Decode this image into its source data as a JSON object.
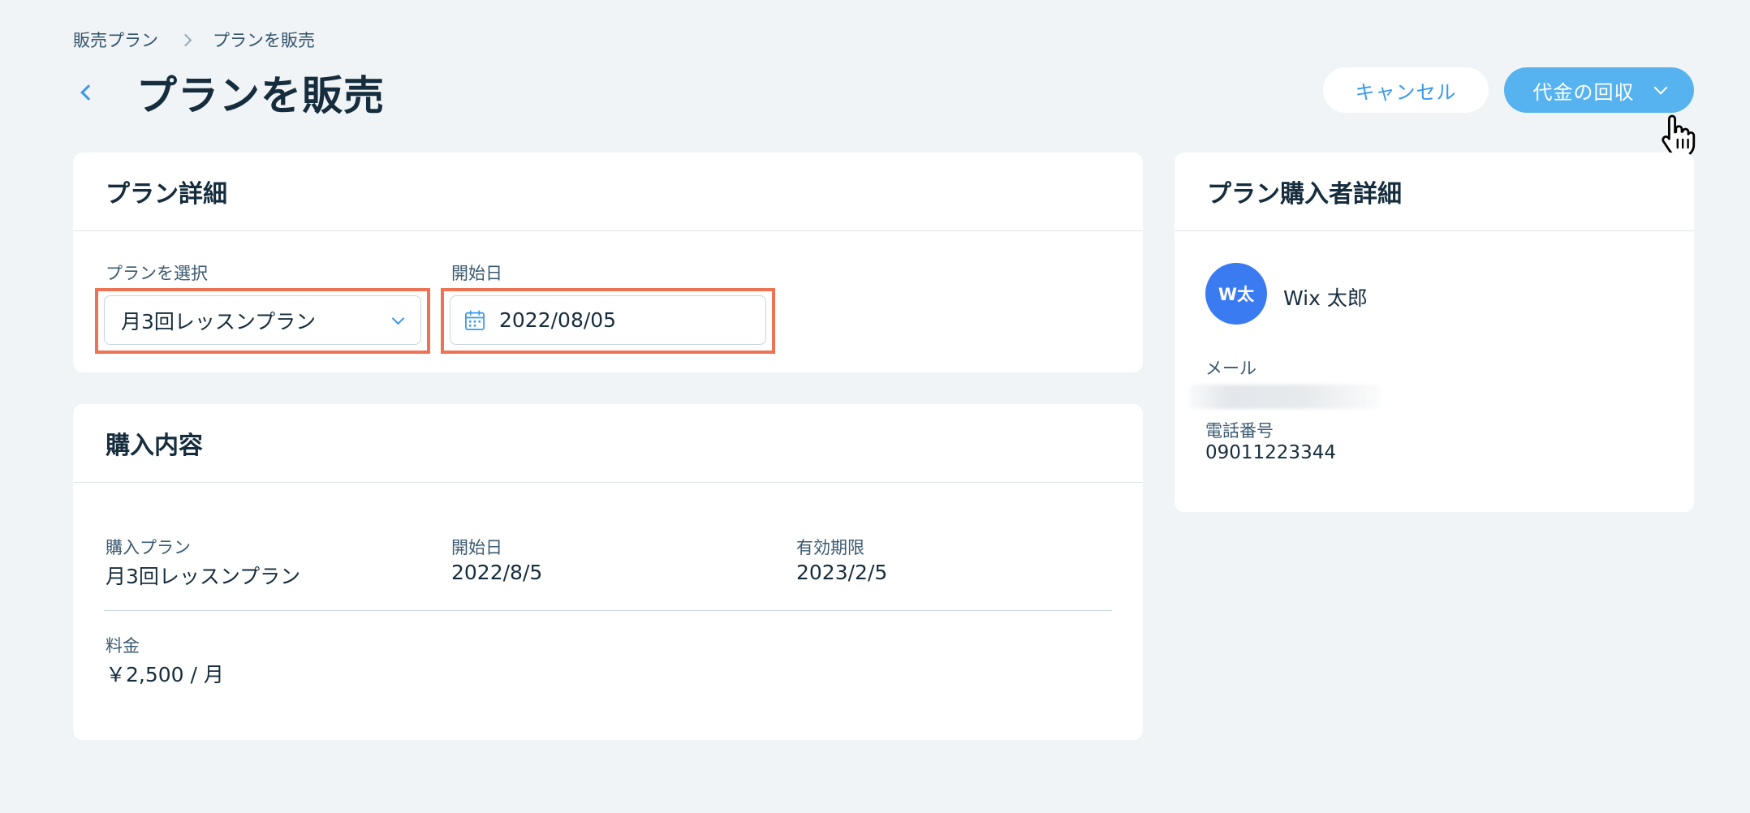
{
  "breadcrumb": {
    "parent": "販売プラン",
    "current": "プランを販売"
  },
  "header": {
    "title": "プランを販売"
  },
  "actions": {
    "cancel_label": "キャンセル",
    "collect_label": "代金の回収"
  },
  "plan_details": {
    "title": "プラン詳細",
    "plan_select": {
      "label": "プランを選択",
      "value": "月3回レッスンプラン"
    },
    "start_date": {
      "label": "開始日",
      "value": "2022/08/05"
    }
  },
  "purchase": {
    "title": "購入内容",
    "plan": {
      "label": "購入プラン",
      "value": "月3回レッスンプラン"
    },
    "start": {
      "label": "開始日",
      "value": "2022/8/5"
    },
    "expiry": {
      "label": "有効期限",
      "value": "2023/2/5"
    },
    "price": {
      "label": "料金",
      "value": "￥2,500 / 月"
    }
  },
  "buyer": {
    "title": "プラン購入者詳細",
    "avatar_initials": "W太",
    "name": "Wix 太郎",
    "email_label": "メール",
    "phone_label": "電話番号",
    "phone": "09011223344"
  },
  "colors": {
    "accent": "#3899ec",
    "primary_button": "#57b3ef",
    "highlight": "#ee7355",
    "avatar": "#3b7bf2"
  }
}
